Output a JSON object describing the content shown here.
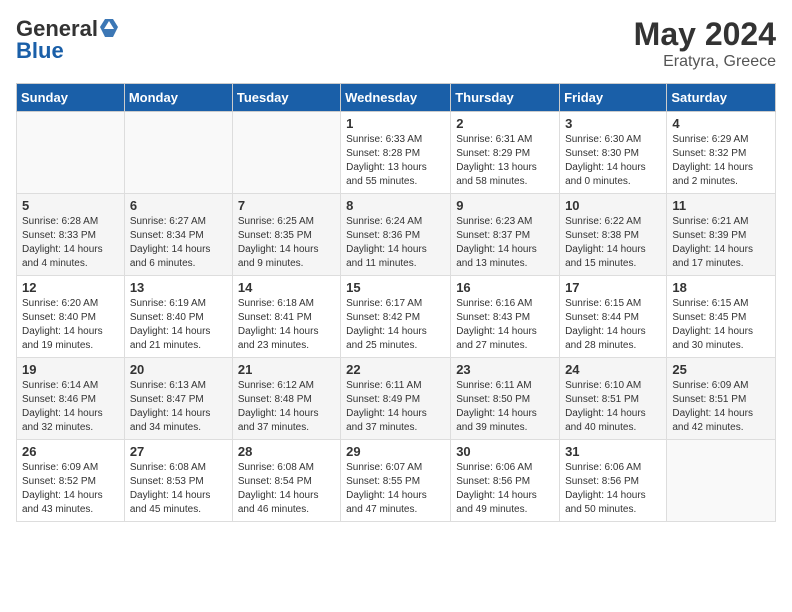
{
  "header": {
    "logo_general": "General",
    "logo_blue": "Blue",
    "month_year": "May 2024",
    "location": "Eratyra, Greece"
  },
  "days_of_week": [
    "Sunday",
    "Monday",
    "Tuesday",
    "Wednesday",
    "Thursday",
    "Friday",
    "Saturday"
  ],
  "weeks": [
    [
      {
        "day": "",
        "sunrise": "",
        "sunset": "",
        "daylight": ""
      },
      {
        "day": "",
        "sunrise": "",
        "sunset": "",
        "daylight": ""
      },
      {
        "day": "",
        "sunrise": "",
        "sunset": "",
        "daylight": ""
      },
      {
        "day": "1",
        "sunrise": "Sunrise: 6:33 AM",
        "sunset": "Sunset: 8:28 PM",
        "daylight": "Daylight: 13 hours and 55 minutes."
      },
      {
        "day": "2",
        "sunrise": "Sunrise: 6:31 AM",
        "sunset": "Sunset: 8:29 PM",
        "daylight": "Daylight: 13 hours and 58 minutes."
      },
      {
        "day": "3",
        "sunrise": "Sunrise: 6:30 AM",
        "sunset": "Sunset: 8:30 PM",
        "daylight": "Daylight: 14 hours and 0 minutes."
      },
      {
        "day": "4",
        "sunrise": "Sunrise: 6:29 AM",
        "sunset": "Sunset: 8:32 PM",
        "daylight": "Daylight: 14 hours and 2 minutes."
      }
    ],
    [
      {
        "day": "5",
        "sunrise": "Sunrise: 6:28 AM",
        "sunset": "Sunset: 8:33 PM",
        "daylight": "Daylight: 14 hours and 4 minutes."
      },
      {
        "day": "6",
        "sunrise": "Sunrise: 6:27 AM",
        "sunset": "Sunset: 8:34 PM",
        "daylight": "Daylight: 14 hours and 6 minutes."
      },
      {
        "day": "7",
        "sunrise": "Sunrise: 6:25 AM",
        "sunset": "Sunset: 8:35 PM",
        "daylight": "Daylight: 14 hours and 9 minutes."
      },
      {
        "day": "8",
        "sunrise": "Sunrise: 6:24 AM",
        "sunset": "Sunset: 8:36 PM",
        "daylight": "Daylight: 14 hours and 11 minutes."
      },
      {
        "day": "9",
        "sunrise": "Sunrise: 6:23 AM",
        "sunset": "Sunset: 8:37 PM",
        "daylight": "Daylight: 14 hours and 13 minutes."
      },
      {
        "day": "10",
        "sunrise": "Sunrise: 6:22 AM",
        "sunset": "Sunset: 8:38 PM",
        "daylight": "Daylight: 14 hours and 15 minutes."
      },
      {
        "day": "11",
        "sunrise": "Sunrise: 6:21 AM",
        "sunset": "Sunset: 8:39 PM",
        "daylight": "Daylight: 14 hours and 17 minutes."
      }
    ],
    [
      {
        "day": "12",
        "sunrise": "Sunrise: 6:20 AM",
        "sunset": "Sunset: 8:40 PM",
        "daylight": "Daylight: 14 hours and 19 minutes."
      },
      {
        "day": "13",
        "sunrise": "Sunrise: 6:19 AM",
        "sunset": "Sunset: 8:40 PM",
        "daylight": "Daylight: 14 hours and 21 minutes."
      },
      {
        "day": "14",
        "sunrise": "Sunrise: 6:18 AM",
        "sunset": "Sunset: 8:41 PM",
        "daylight": "Daylight: 14 hours and 23 minutes."
      },
      {
        "day": "15",
        "sunrise": "Sunrise: 6:17 AM",
        "sunset": "Sunset: 8:42 PM",
        "daylight": "Daylight: 14 hours and 25 minutes."
      },
      {
        "day": "16",
        "sunrise": "Sunrise: 6:16 AM",
        "sunset": "Sunset: 8:43 PM",
        "daylight": "Daylight: 14 hours and 27 minutes."
      },
      {
        "day": "17",
        "sunrise": "Sunrise: 6:15 AM",
        "sunset": "Sunset: 8:44 PM",
        "daylight": "Daylight: 14 hours and 28 minutes."
      },
      {
        "day": "18",
        "sunrise": "Sunrise: 6:15 AM",
        "sunset": "Sunset: 8:45 PM",
        "daylight": "Daylight: 14 hours and 30 minutes."
      }
    ],
    [
      {
        "day": "19",
        "sunrise": "Sunrise: 6:14 AM",
        "sunset": "Sunset: 8:46 PM",
        "daylight": "Daylight: 14 hours and 32 minutes."
      },
      {
        "day": "20",
        "sunrise": "Sunrise: 6:13 AM",
        "sunset": "Sunset: 8:47 PM",
        "daylight": "Daylight: 14 hours and 34 minutes."
      },
      {
        "day": "21",
        "sunrise": "Sunrise: 6:12 AM",
        "sunset": "Sunset: 8:48 PM",
        "daylight": "Daylight: 14 hours and 37 minutes."
      },
      {
        "day": "22",
        "sunrise": "Sunrise: 6:11 AM",
        "sunset": "Sunset: 8:49 PM",
        "daylight": "Daylight: 14 hours and 37 minutes."
      },
      {
        "day": "23",
        "sunrise": "Sunrise: 6:11 AM",
        "sunset": "Sunset: 8:50 PM",
        "daylight": "Daylight: 14 hours and 39 minutes."
      },
      {
        "day": "24",
        "sunrise": "Sunrise: 6:10 AM",
        "sunset": "Sunset: 8:51 PM",
        "daylight": "Daylight: 14 hours and 40 minutes."
      },
      {
        "day": "25",
        "sunrise": "Sunrise: 6:09 AM",
        "sunset": "Sunset: 8:51 PM",
        "daylight": "Daylight: 14 hours and 42 minutes."
      }
    ],
    [
      {
        "day": "26",
        "sunrise": "Sunrise: 6:09 AM",
        "sunset": "Sunset: 8:52 PM",
        "daylight": "Daylight: 14 hours and 43 minutes."
      },
      {
        "day": "27",
        "sunrise": "Sunrise: 6:08 AM",
        "sunset": "Sunset: 8:53 PM",
        "daylight": "Daylight: 14 hours and 45 minutes."
      },
      {
        "day": "28",
        "sunrise": "Sunrise: 6:08 AM",
        "sunset": "Sunset: 8:54 PM",
        "daylight": "Daylight: 14 hours and 46 minutes."
      },
      {
        "day": "29",
        "sunrise": "Sunrise: 6:07 AM",
        "sunset": "Sunset: 8:55 PM",
        "daylight": "Daylight: 14 hours and 47 minutes."
      },
      {
        "day": "30",
        "sunrise": "Sunrise: 6:06 AM",
        "sunset": "Sunset: 8:56 PM",
        "daylight": "Daylight: 14 hours and 49 minutes."
      },
      {
        "day": "31",
        "sunrise": "Sunrise: 6:06 AM",
        "sunset": "Sunset: 8:56 PM",
        "daylight": "Daylight: 14 hours and 50 minutes."
      },
      {
        "day": "",
        "sunrise": "",
        "sunset": "",
        "daylight": ""
      }
    ]
  ]
}
